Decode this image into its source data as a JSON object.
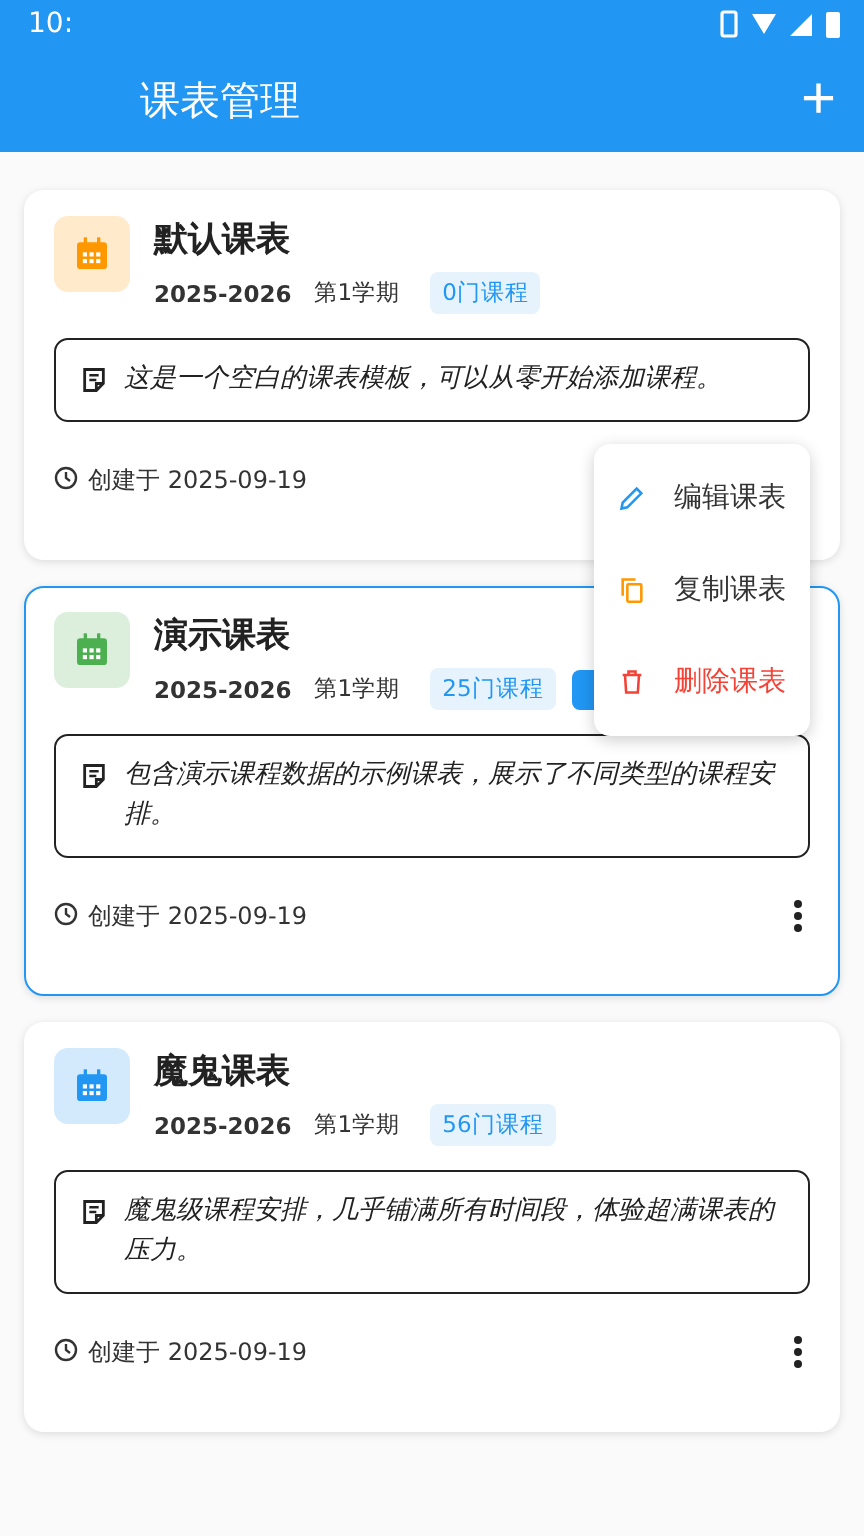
{
  "status_bar": {
    "time": "10:"
  },
  "app_bar": {
    "title": "课表管理",
    "add_icon": "+"
  },
  "schedules": [
    {
      "name": "默认课表",
      "year": "2025-2026",
      "term": "第1学期",
      "count": "0门课程",
      "color": "#ff9800",
      "selected": false,
      "description": "这是一个空白的课表模板，可以从零开始添加课程。",
      "created": "创建于 2025-09-19",
      "menu_open": true
    },
    {
      "name": "演示课表",
      "year": "2025-2026",
      "term": "第1学期",
      "count": "25门课程",
      "current_tag": true,
      "color": "#4caf50",
      "selected": true,
      "description": "包含演示课程数据的示例课表，展示了不同类型的课程安排。",
      "created": "创建于 2025-09-19",
      "menu_open": false
    },
    {
      "name": "魔鬼课表",
      "year": "2025-2026",
      "term": "第1学期",
      "count": "56门课程",
      "color": "#2196f3",
      "selected": false,
      "description": "魔鬼级课程安排，几乎铺满所有时间段，体验超满课表的压力。",
      "created": "创建于 2025-09-19",
      "menu_open": false
    }
  ],
  "menu": [
    {
      "label": "编辑课表",
      "kind": "edit"
    },
    {
      "label": "复制课表",
      "kind": "copy"
    },
    {
      "label": "删除课表",
      "kind": "delete"
    }
  ]
}
